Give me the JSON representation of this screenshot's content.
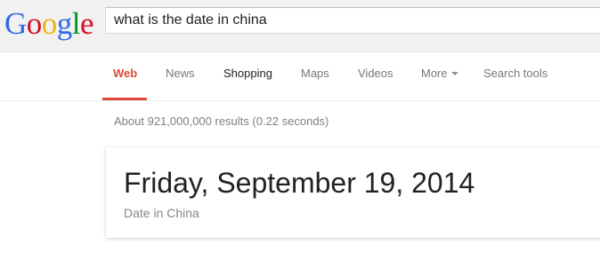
{
  "logo": {
    "letters": [
      {
        "char": "G",
        "color": "#3369e8"
      },
      {
        "char": "o",
        "color": "#d50f25"
      },
      {
        "char": "o",
        "color": "#eeb211"
      },
      {
        "char": "g",
        "color": "#3369e8"
      },
      {
        "char": "l",
        "color": "#009925"
      },
      {
        "char": "e",
        "color": "#d50f25"
      }
    ]
  },
  "search": {
    "query": "what is the date in china"
  },
  "tabs": {
    "web": "Web",
    "news": "News",
    "shopping": "Shopping",
    "maps": "Maps",
    "videos": "Videos",
    "more": "More",
    "search_tools": "Search tools",
    "active": "web"
  },
  "results": {
    "count_text": "About 921,000,000 results (0.22 seconds)"
  },
  "answer": {
    "date": "Friday, September 19, 2014",
    "caption": "Date in China"
  },
  "colors": {
    "accent": "#dd4b39",
    "topbar_bg": "#f1f1f1"
  }
}
